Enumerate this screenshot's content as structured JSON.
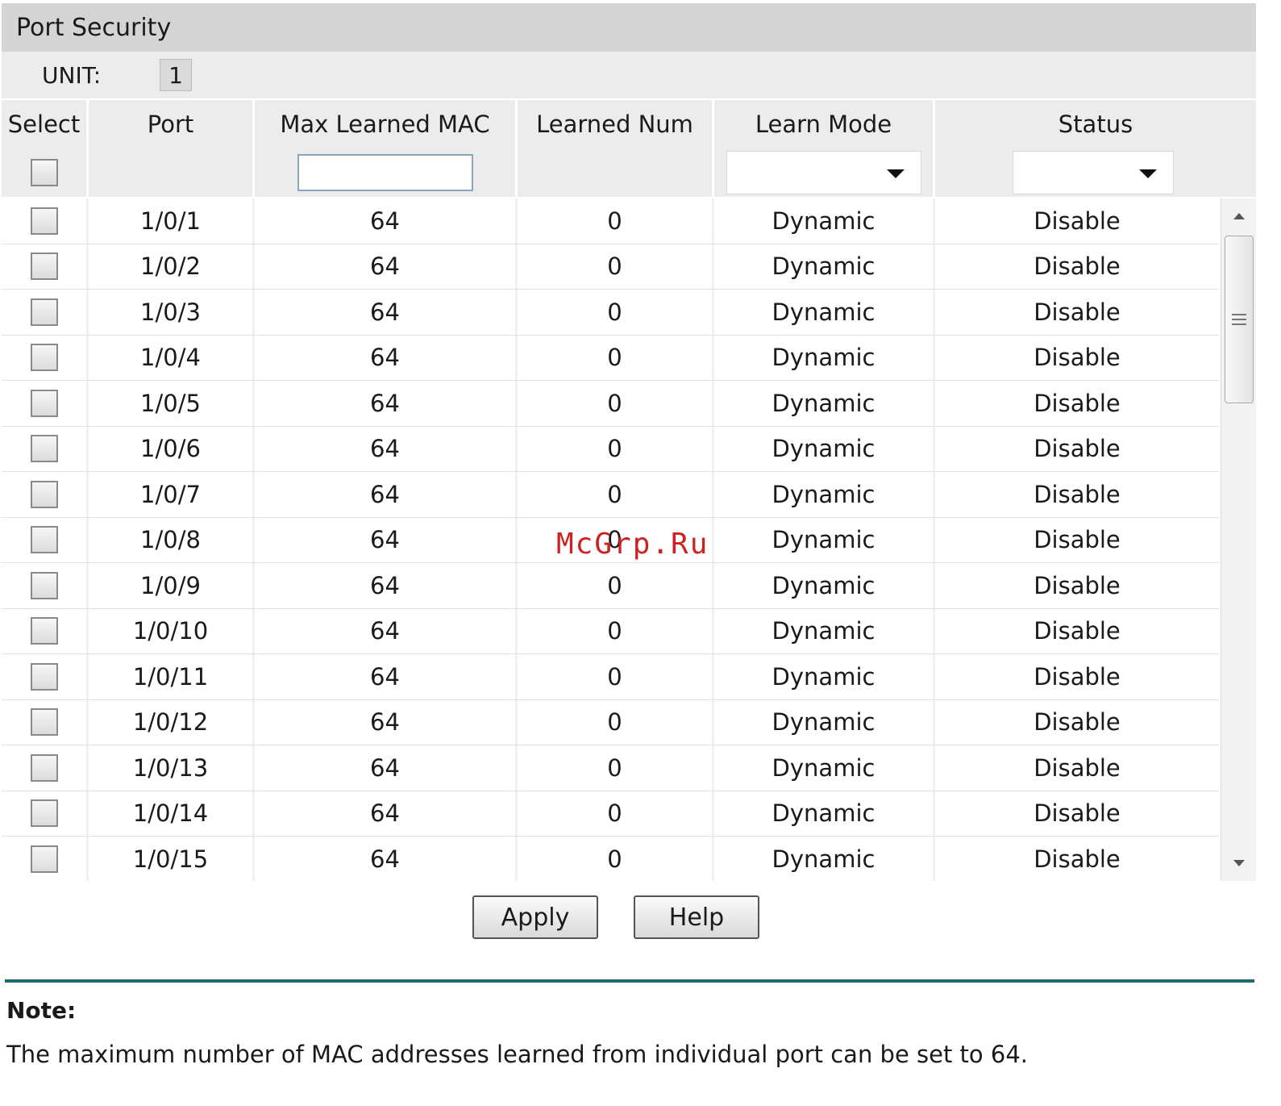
{
  "panel": {
    "title": "Port Security"
  },
  "unit": {
    "label": "UNIT:",
    "value": "1"
  },
  "columns": {
    "select": "Select",
    "port": "Port",
    "max_learned": "Max Learned MAC",
    "learned_num": "Learned Num",
    "learn_mode": "Learn Mode",
    "status": "Status"
  },
  "filter": {
    "max_learned_value": "",
    "learn_mode_selected": "",
    "status_selected": ""
  },
  "rows": [
    {
      "port": "1/0/1",
      "max": "64",
      "num": "0",
      "mode": "Dynamic",
      "status": "Disable"
    },
    {
      "port": "1/0/2",
      "max": "64",
      "num": "0",
      "mode": "Dynamic",
      "status": "Disable"
    },
    {
      "port": "1/0/3",
      "max": "64",
      "num": "0",
      "mode": "Dynamic",
      "status": "Disable"
    },
    {
      "port": "1/0/4",
      "max": "64",
      "num": "0",
      "mode": "Dynamic",
      "status": "Disable"
    },
    {
      "port": "1/0/5",
      "max": "64",
      "num": "0",
      "mode": "Dynamic",
      "status": "Disable"
    },
    {
      "port": "1/0/6",
      "max": "64",
      "num": "0",
      "mode": "Dynamic",
      "status": "Disable"
    },
    {
      "port": "1/0/7",
      "max": "64",
      "num": "0",
      "mode": "Dynamic",
      "status": "Disable"
    },
    {
      "port": "1/0/8",
      "max": "64",
      "num": "0",
      "mode": "Dynamic",
      "status": "Disable"
    },
    {
      "port": "1/0/9",
      "max": "64",
      "num": "0",
      "mode": "Dynamic",
      "status": "Disable"
    },
    {
      "port": "1/0/10",
      "max": "64",
      "num": "0",
      "mode": "Dynamic",
      "status": "Disable"
    },
    {
      "port": "1/0/11",
      "max": "64",
      "num": "0",
      "mode": "Dynamic",
      "status": "Disable"
    },
    {
      "port": "1/0/12",
      "max": "64",
      "num": "0",
      "mode": "Dynamic",
      "status": "Disable"
    },
    {
      "port": "1/0/13",
      "max": "64",
      "num": "0",
      "mode": "Dynamic",
      "status": "Disable"
    },
    {
      "port": "1/0/14",
      "max": "64",
      "num": "0",
      "mode": "Dynamic",
      "status": "Disable"
    },
    {
      "port": "1/0/15",
      "max": "64",
      "num": "0",
      "mode": "Dynamic",
      "status": "Disable"
    }
  ],
  "buttons": {
    "apply": "Apply",
    "help": "Help"
  },
  "note": {
    "title": "Note:",
    "text": "The maximum number of MAC addresses learned from individual port can be set to 64."
  },
  "watermark": "McGrp.Ru",
  "colors": {
    "divider": "#1d6a6f",
    "header_bg": "#d4d4d4",
    "table_header_bg": "#ececec"
  }
}
